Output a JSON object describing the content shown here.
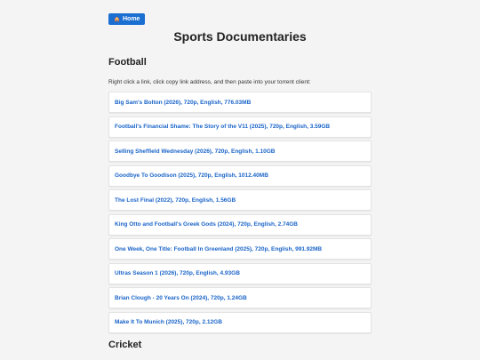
{
  "nav": {
    "home_label": "Home"
  },
  "page": {
    "title": "Sports Documentaries"
  },
  "sections": [
    {
      "title": "Football",
      "instructions": "Right click a link, click copy link address, and then paste into your torrent client:",
      "links": [
        "Big Sam's Bolton (2026), 720p, English, 776.03MB",
        "Football's Financial Shame: The Story of the V11 (2025), 720p, English, 3.59GB",
        "Selling Sheffield Wednesday (2026), 720p, English, 1.10GB",
        "Goodbye To Goodison (2025), 720p, English, 1012.40MB",
        "The Lost Final (2022), 720p, English, 1.56GB",
        "King Otto and Football's Greek Gods (2024), 720p, English, 2.74GB",
        "One Week, One Title: Football In Greenland (2025), 720p, English, 991.92MB",
        "Ultras Season 1 (2026), 720p, English, 4.93GB",
        "Brian Clough - 20 Years On (2024), 720p, 1.24GB",
        "Make It To Munich (2025), 720p, 2.12GB"
      ]
    },
    {
      "title": "Cricket"
    }
  ],
  "colors": {
    "accent": "#1a6fd1",
    "link": "#1a64c8",
    "background": "#f4f4f4"
  },
  "icons": {
    "home": "house-icon"
  }
}
